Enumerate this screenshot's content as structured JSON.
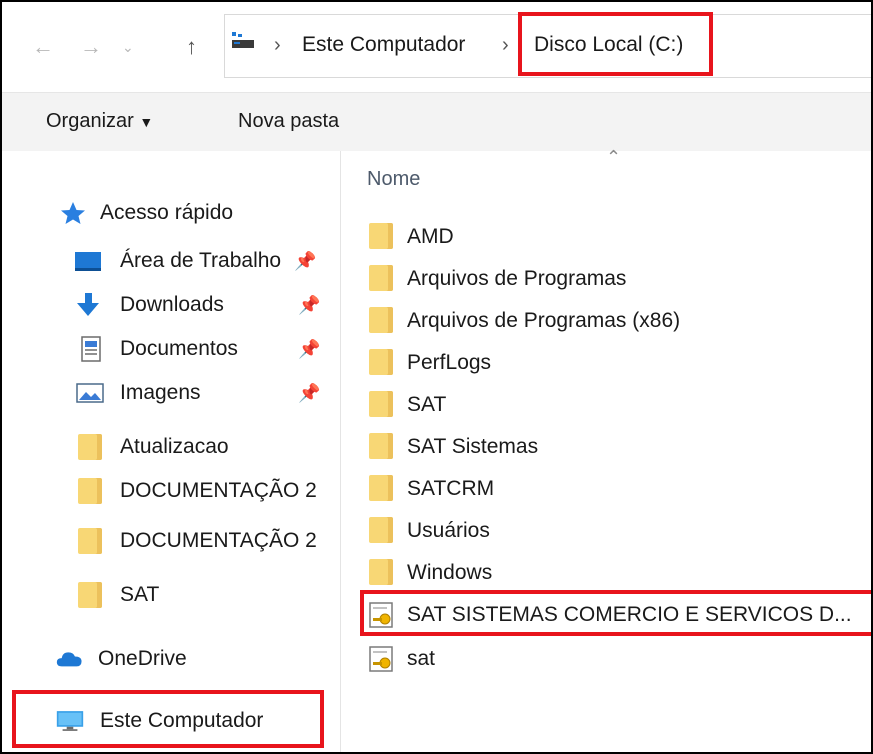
{
  "address": {
    "back_icon": "back-arrow-icon",
    "forward_icon": "forward-arrow-icon",
    "history_icon": "chevron-down-icon",
    "up_icon": "up-arrow-icon",
    "location_icon": "pc-icon",
    "crumbs": [
      "Este Computador",
      "Disco Local (C:)"
    ]
  },
  "toolbar": {
    "organize_label": "Organizar",
    "new_folder_label": "Nova pasta"
  },
  "sidebar": {
    "quick_access": "Acesso rápido",
    "items": [
      {
        "label": "Área de Trabalho",
        "icon": "desktop-icon",
        "pinned": true
      },
      {
        "label": "Downloads",
        "icon": "download-icon",
        "pinned": true
      },
      {
        "label": "Documentos",
        "icon": "document-icon",
        "pinned": true
      },
      {
        "label": "Imagens",
        "icon": "image-icon",
        "pinned": true
      },
      {
        "label": "Atualizacao",
        "icon": "folder-icon",
        "pinned": false
      },
      {
        "label": "DOCUMENTAÇÃO 2",
        "icon": "folder-icon",
        "pinned": false
      },
      {
        "label": "DOCUMENTAÇÃO 2",
        "icon": "folder-icon",
        "pinned": false
      },
      {
        "label": "SAT",
        "icon": "folder-icon",
        "pinned": false
      }
    ],
    "onedrive": "OneDrive",
    "this_pc": "Este Computador"
  },
  "main": {
    "column_name": "Nome",
    "files": [
      {
        "name": "AMD",
        "type": "folder"
      },
      {
        "name": "Arquivos de Programas",
        "type": "folder"
      },
      {
        "name": "Arquivos de Programas (x86)",
        "type": "folder"
      },
      {
        "name": "PerfLogs",
        "type": "folder"
      },
      {
        "name": "SAT",
        "type": "folder"
      },
      {
        "name": "SAT Sistemas",
        "type": "folder"
      },
      {
        "name": "SATCRM",
        "type": "folder"
      },
      {
        "name": "Usuários",
        "type": "folder"
      },
      {
        "name": "Windows",
        "type": "folder"
      },
      {
        "name": "SAT SISTEMAS COMERCIO E SERVICOS D...",
        "type": "certificate"
      },
      {
        "name": "sat",
        "type": "certificate"
      }
    ]
  },
  "colors": {
    "highlight": "#e8141c",
    "folder": "#f8d775",
    "accent_blue": "#1e78d4"
  }
}
